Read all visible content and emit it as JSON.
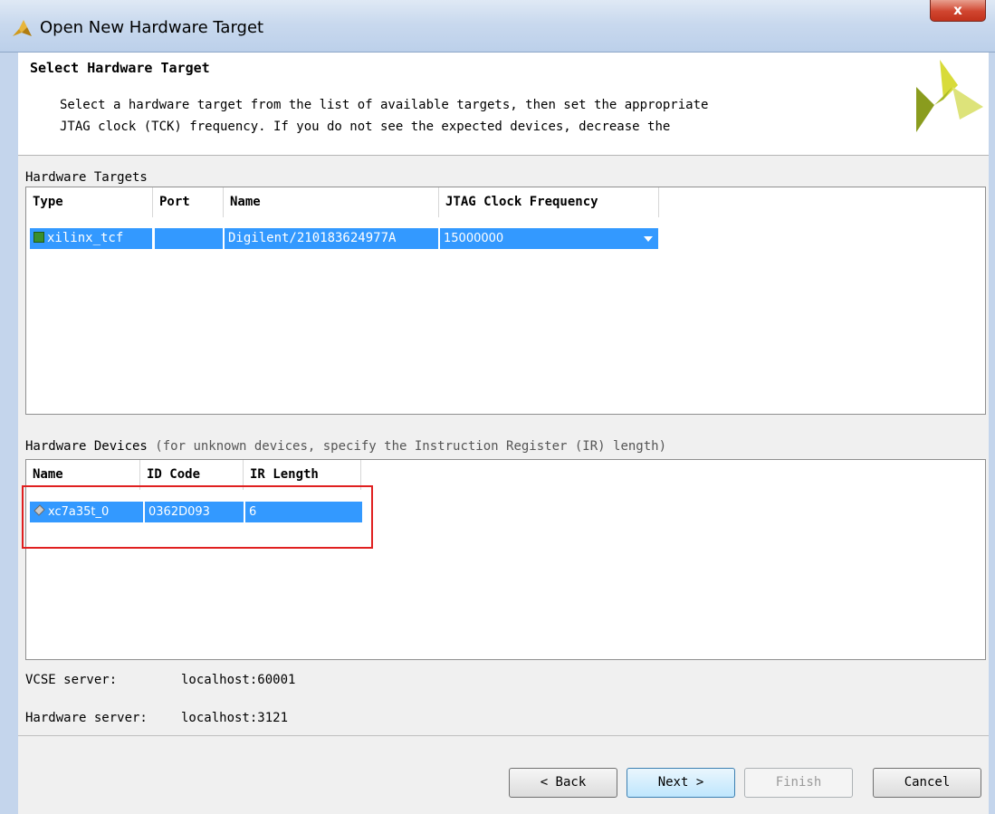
{
  "window": {
    "title": "Open New Hardware Target",
    "close_label": "x"
  },
  "header": {
    "title": "Select Hardware Target",
    "description": "Select a hardware target from the list of available targets, then set the appropriate\nJTAG clock (TCK) frequency. If you do not see the expected devices, decrease the"
  },
  "targets": {
    "label": "Hardware Targets",
    "columns": [
      "Type",
      "Port",
      "Name",
      "JTAG Clock Frequency"
    ],
    "rows": [
      {
        "type": "xilinx_tcf",
        "port": "",
        "name": "Digilent/210183624977A",
        "frequency": "15000000"
      }
    ]
  },
  "devices": {
    "label": "Hardware Devices",
    "hint": "(for unknown devices, specify the Instruction Register (IR) length)",
    "columns": [
      "Name",
      "ID Code",
      "IR Length"
    ],
    "rows": [
      {
        "name": "xc7a35t_0",
        "id_code": "0362D093",
        "ir_length": "6"
      }
    ]
  },
  "servers": {
    "vcse_label": "VCSE server:",
    "vcse_value": "localhost:60001",
    "hw_label": "Hardware server:",
    "hw_value": "localhost:3121"
  },
  "buttons": {
    "back": "< Back",
    "next": "Next >",
    "finish": "Finish",
    "cancel": "Cancel"
  },
  "colors": {
    "selection": "#3399ff",
    "annotation": "#e02020"
  }
}
